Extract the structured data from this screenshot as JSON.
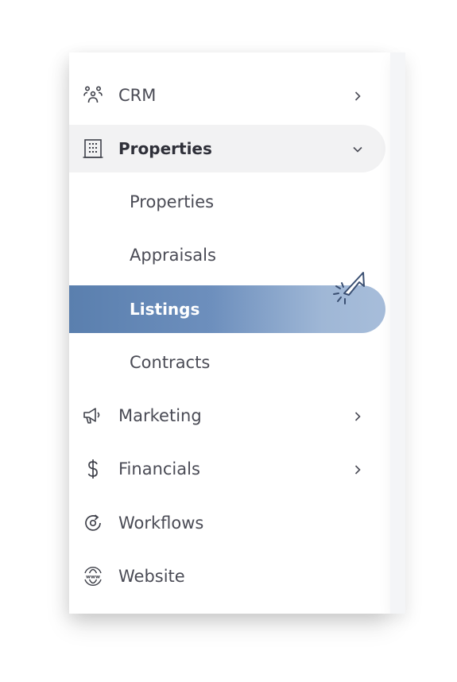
{
  "nav": {
    "items": [
      {
        "label": "CRM",
        "icon": "people-group-icon",
        "chevron": "right"
      },
      {
        "label": "Properties",
        "icon": "building-icon",
        "chevron": "down",
        "active": true,
        "children": [
          {
            "label": "Properties"
          },
          {
            "label": "Appraisals"
          },
          {
            "label": "Listings",
            "selected": true
          },
          {
            "label": "Contracts"
          }
        ]
      },
      {
        "label": "Marketing",
        "icon": "megaphone-icon",
        "chevron": "right"
      },
      {
        "label": "Financials",
        "icon": "dollar-icon",
        "chevron": "right"
      },
      {
        "label": "Workflows",
        "icon": "workflow-cycle-icon"
      },
      {
        "label": "Website",
        "icon": "globe-www-icon"
      }
    ]
  },
  "colors": {
    "selected_start": "#5a7fae",
    "selected_end": "#a7bdda",
    "active_bg": "#f2f2f3",
    "text": "#4a4b55"
  }
}
